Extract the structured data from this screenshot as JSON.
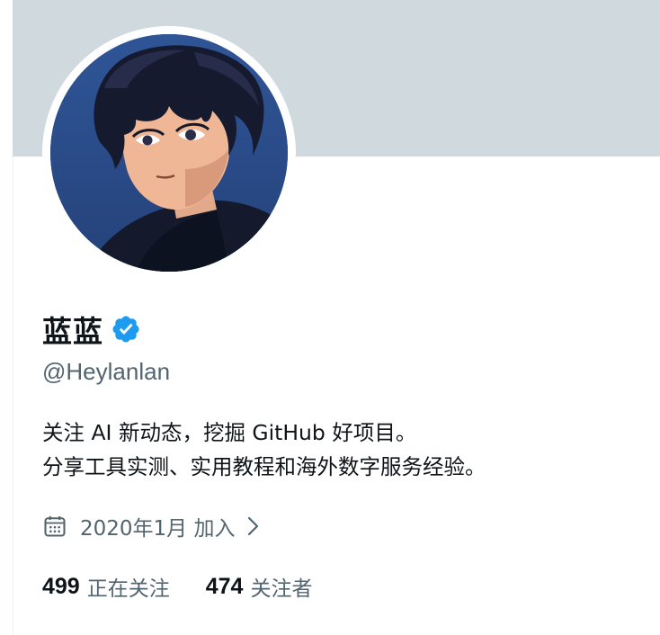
{
  "profile": {
    "display_name": "蓝蓝",
    "handle": "@Heylanlan",
    "verified_icon": "verified-badge-icon",
    "bio_lines": [
      "关注 AI 新动态，挖掘 GitHub 好项目。",
      "分享工具实测、实用教程和海外数字服务经验。"
    ],
    "joined": "2020年1月 加入",
    "following": {
      "count": "499",
      "label": "正在关注"
    },
    "followers": {
      "count": "474",
      "label": "关注者"
    }
  },
  "colors": {
    "banner": "#cfd9de",
    "verified": "#1d9bf0",
    "secondary_text": "#536471",
    "primary_text": "#0f1419"
  },
  "icons": {
    "calendar": "calendar-icon",
    "chevron": "chevron-right-icon"
  }
}
